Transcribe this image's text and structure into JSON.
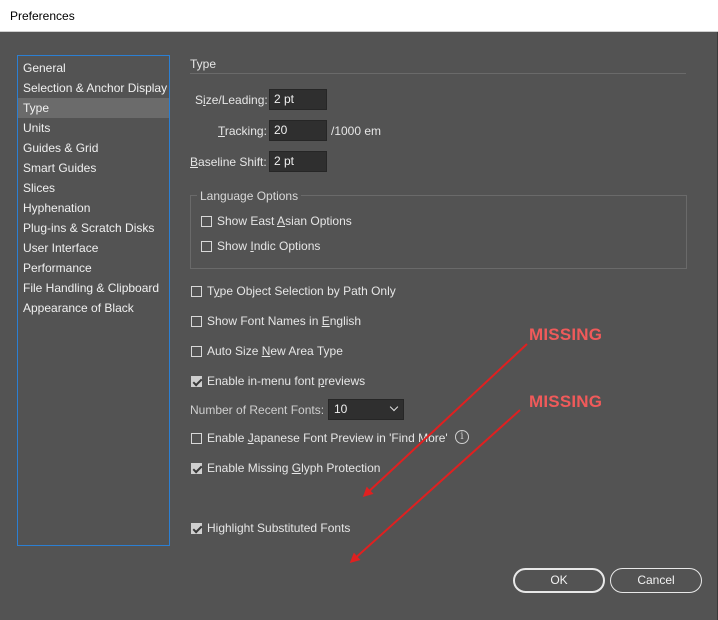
{
  "window": {
    "title": "Preferences"
  },
  "sidebar": {
    "items": [
      {
        "label": "General"
      },
      {
        "label": "Selection & Anchor Display"
      },
      {
        "label": "Type",
        "selected": true
      },
      {
        "label": "Units"
      },
      {
        "label": "Guides & Grid"
      },
      {
        "label": "Smart Guides"
      },
      {
        "label": "Slices"
      },
      {
        "label": "Hyphenation"
      },
      {
        "label": "Plug-ins & Scratch Disks"
      },
      {
        "label": "User Interface"
      },
      {
        "label": "Performance"
      },
      {
        "label": "File Handling & Clipboard"
      },
      {
        "label": "Appearance of Black"
      }
    ]
  },
  "type_section": {
    "title": "Type",
    "size_leading": {
      "label_pre": "S",
      "label_u": "i",
      "label_post": "ze/Leading:",
      "value": "2 pt"
    },
    "tracking": {
      "label_u": "T",
      "label_post": "racking:",
      "value": "20",
      "unit": "/1000 em"
    },
    "baseline_shift": {
      "label_u": "B",
      "label_post": "aseline Shift:",
      "value": "2 pt"
    }
  },
  "language_options": {
    "title": "Language Options",
    "east_asian": {
      "pre": "Show East ",
      "u": "A",
      "post": "sian Options",
      "checked": false
    },
    "indic": {
      "pre": "Show ",
      "u": "I",
      "post": "ndic Options",
      "checked": false
    }
  },
  "options": {
    "type_object_selection": {
      "pre": "T",
      "u": "y",
      "post": "pe Object Selection by Path Only",
      "checked": false
    },
    "font_names_english": {
      "pre": "Show Font Names in ",
      "u": "E",
      "post": "nglish",
      "checked": false
    },
    "auto_size": {
      "pre": "Auto Size ",
      "u": "N",
      "post": "ew Area Type",
      "checked": false
    },
    "in_menu_previews": {
      "pre": "Enable in-menu font ",
      "u": "p",
      "post": "reviews",
      "checked": true
    },
    "recent_fonts": {
      "label": "Number of Recent Fonts:",
      "value": "10"
    },
    "japanese_preview": {
      "pre": "Enable ",
      "u": "J",
      "post": "apanese Font Preview in 'Find More'",
      "checked": false
    },
    "missing_glyph": {
      "pre": "Enable Missing ",
      "u": "G",
      "post": "lyph Protection",
      "checked": true
    },
    "highlight_substituted": {
      "label": "Highlight Substituted Fonts",
      "checked": true
    }
  },
  "buttons": {
    "ok": "OK",
    "cancel": "Cancel"
  },
  "annotations": {
    "missing_1": "MISSING",
    "missing_2": "MISSING",
    "color": "#f05a5a",
    "arrow_color": "#e02020"
  },
  "icons": {
    "info": "info-circle-icon",
    "dropdown": "chevron-down-icon",
    "check": "checkmark-icon"
  }
}
